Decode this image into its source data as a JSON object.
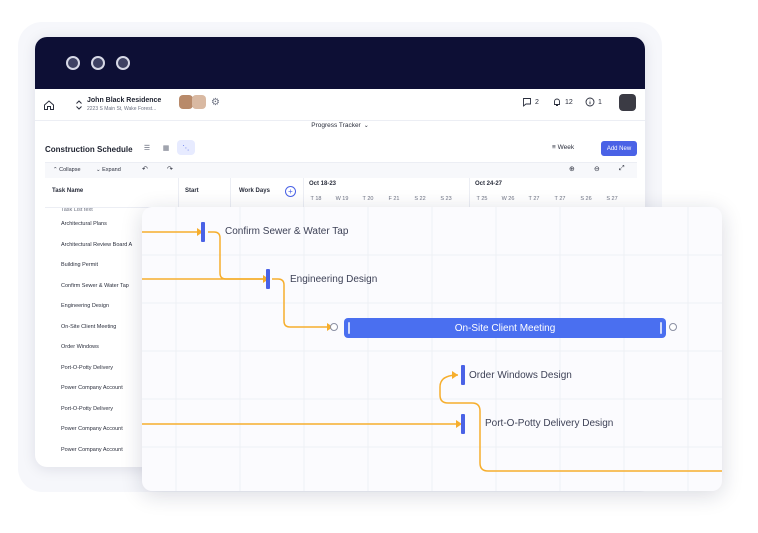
{
  "header": {
    "project_name": "John Black Residence",
    "project_address": "2223 S Main St, Wake Forest...",
    "comments_count": "2",
    "notifications_count": "12",
    "info_count": "1"
  },
  "tracker": {
    "label": "Progress Tracker"
  },
  "schedule": {
    "title": "Construction Schedule",
    "week_label": "Week",
    "add_new_label": "Add New"
  },
  "toolbar": {
    "collapse_label": "Collapse",
    "expand_label": "Expand"
  },
  "grid": {
    "columns": [
      "Task Name",
      "Start",
      "Work Days"
    ],
    "weeks": [
      {
        "label": "Oct 18-23",
        "days": [
          "T 18",
          "W 19",
          "T 20",
          "F 21",
          "S 22",
          "S 23"
        ]
      },
      {
        "label": "Oct 24-27",
        "days": [
          "T 25",
          "W 26",
          "T 27",
          "T 27",
          "S 26",
          "S 27"
        ]
      }
    ],
    "tasks_partial": "Task List text",
    "tasks": [
      "Architectural Plans",
      "Architectural Review Board A",
      "Building Permit",
      "Confirm Sewer & Water Tap",
      "Engineering Design",
      "On-Site Client Meeting",
      "Order Windows",
      "Port-O-Potty Delivery",
      "Power Company Account",
      "Port-O-Potty Delivery",
      "Power Company Account",
      "Power Company Account"
    ]
  },
  "gantt": {
    "confirm_sewer": "Confirm Sewer & Water Tap",
    "engineering": "Engineering Design",
    "onsite": "On-Site Client Meeting",
    "order_windows": "Order Windows Design",
    "port_o_potty": "Port-O-Potty Delivery Design"
  },
  "colors": {
    "accent": "#4a62e6",
    "bar": "#4a6ff0",
    "dependency": "#f6ae2d",
    "titlebar": "#0d0f35"
  },
  "icons": [
    "home-icon",
    "gear-icon",
    "comment-icon",
    "bell-icon",
    "info-icon",
    "list-view-icon",
    "grid-view-icon",
    "gantt-view-icon",
    "filter-icon",
    "undo-icon",
    "redo-icon",
    "zoom-in-icon",
    "zoom-out-icon",
    "fullscreen-icon",
    "add-column-icon"
  ]
}
